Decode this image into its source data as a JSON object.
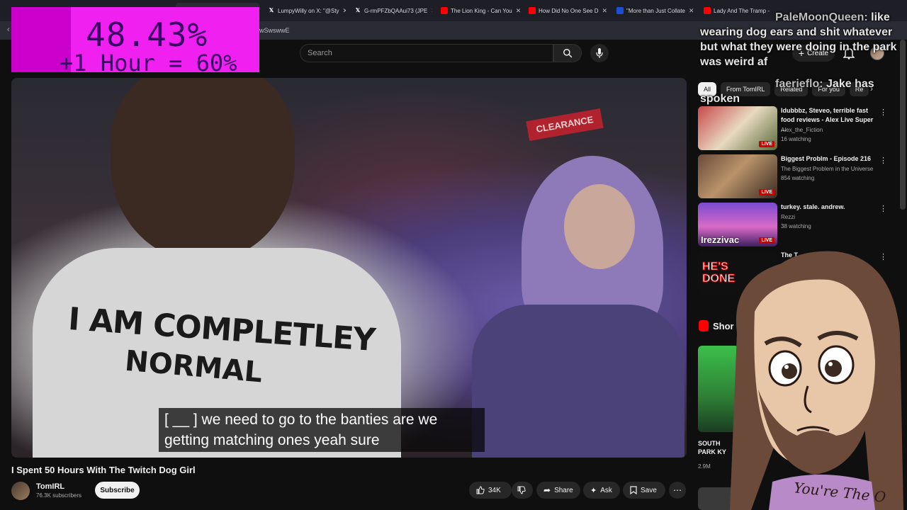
{
  "browser": {
    "tabs": [
      {
        "title": "LumpyWilly on X: \"@Sty",
        "icon": "x-logo"
      },
      {
        "title": "G-rmPFZbQAAui73 (JPE",
        "icon": "x-logo"
      },
      {
        "title": "The Lion King - Can You",
        "icon": "youtube-icon"
      },
      {
        "title": "How Did No One See D",
        "icon": "youtube-icon"
      },
      {
        "title": "\"More than Just Collate",
        "icon": "shield-icon"
      },
      {
        "title": "Lady And The Tramp -",
        "icon": "youtube-icon"
      }
    ],
    "address_fragment": "wSwswwE"
  },
  "youtube": {
    "search_placeholder": "Search",
    "create_label": "Create"
  },
  "overlay": {
    "percent": "48.43%",
    "hour_bonus": "+1 Hour = 60%",
    "chat": [
      {
        "name": "PaleMoonQueen:",
        "text": "like wearing dog ears and shit whatever but what they were doing in the park was weird af"
      },
      {
        "name": "faerieflo:",
        "text": "Jake has spoken"
      }
    ],
    "signature": "You're The O"
  },
  "video": {
    "caption_line1": "[ __ ] we need to go to the banties are we",
    "caption_line2": "getting matching ones yeah sure",
    "shirt_line1": "I AM COMPLETLEY",
    "shirt_line2": "NORMAL",
    "store_sign": "CLEARANCE",
    "title": "I Spent 50 Hours With The Twitch Dog Girl",
    "channel": "TomIRL",
    "subscribers": "76.3K subscribers",
    "subscribe_label": "Subscribe",
    "likes": "34K",
    "share_label": "Share",
    "ask_label": "Ask",
    "save_label": "Save"
  },
  "sidebar": {
    "chips": [
      "All",
      "From TomIRL",
      "Related",
      "For you",
      "Re"
    ],
    "recommendations": [
      {
        "title": "Idubbbz, Steveo, terrible fast food reviews - Alex Live Super ...",
        "channel": "Alex_the_Fiction",
        "meta": "16 watching",
        "live": "LIVE"
      },
      {
        "title": "Biggest Problm - Episode 216",
        "channel": "The Biggest Problem in the Universe",
        "meta": "854 watching",
        "live": "LIVE"
      },
      {
        "title": "turkey. stale. andrew.",
        "channel": "Rezzi",
        "meta": "38 watching",
        "live": "LIVE",
        "thumb_text": "Irezzivac"
      },
      {
        "title": "The T...",
        "channel": "",
        "meta": "",
        "thumb_text": "HE'S DONE"
      }
    ],
    "shorts_label": "Shor",
    "short_caption": "SOUTH PARK KY",
    "short_views": "2.9M"
  },
  "colors": {
    "overlay_magenta": "#f020f0",
    "live_red": "#cc0000",
    "yt_red": "#ff0000"
  }
}
